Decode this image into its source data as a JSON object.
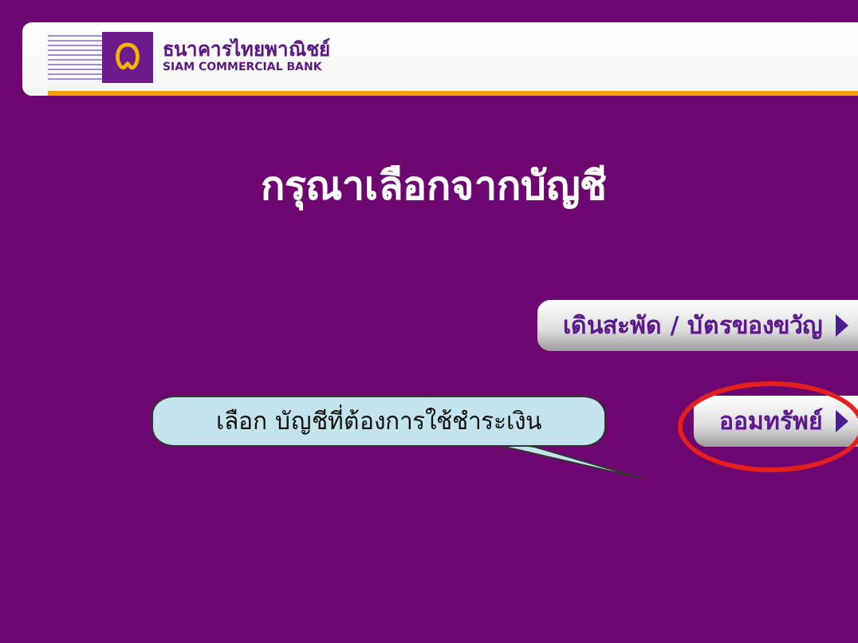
{
  "header": {
    "bank_name_thai": "ธนาคารไทยพาณิชย์",
    "bank_name_english": "SIAM COMMERCIAL BANK"
  },
  "title": "กรุณาเลือกจากบัญชี",
  "options": [
    {
      "label": "เดินสะพัด / บัตรของขวัญ",
      "highlighted": false
    },
    {
      "label": "ออมทรัพย์",
      "highlighted": true
    }
  ],
  "callout": {
    "text": "เลือก บัญชีที่ต้องการใช้ชำระเงิน"
  }
}
